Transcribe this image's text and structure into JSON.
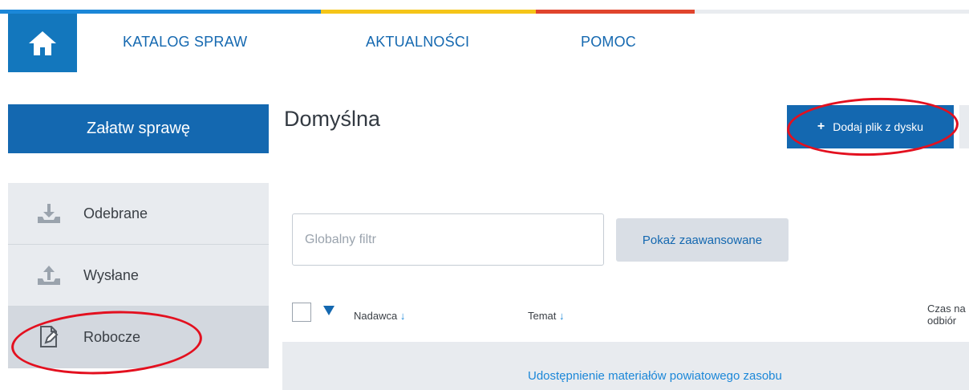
{
  "nav": {
    "home_label": "",
    "items": [
      {
        "label": "KATALOG SPRAW"
      },
      {
        "label": "AKTUALNOŚCI"
      },
      {
        "label": "POMOC"
      }
    ]
  },
  "primary_button": {
    "label": "Załatw sprawę"
  },
  "page": {
    "title": "Domyślna"
  },
  "toolbar": {
    "add_file_label": "Dodaj plik z dysku",
    "add_icon": "+"
  },
  "sidebar": {
    "items": [
      {
        "label": "Odebrane",
        "icon": "download-tray-icon"
      },
      {
        "label": "Wysłane",
        "icon": "upload-tray-icon"
      },
      {
        "label": "Robocze",
        "icon": "edit-document-icon"
      }
    ]
  },
  "filter": {
    "placeholder": "Globalny filtr",
    "advanced_label": "Pokaż zaawansowane"
  },
  "table": {
    "columns": [
      {
        "label": "Nadawca",
        "sort": "↓"
      },
      {
        "label": "Temat",
        "sort": "↓"
      },
      {
        "label_line1": "Czas na",
        "label_line2": "odbiór"
      }
    ],
    "rows": [
      {
        "subject": "Udostępnienie materiałów powiatowego zasobu"
      }
    ]
  },
  "colors": {
    "accent": "#1468b0",
    "link": "#1b87d8",
    "annotation": "#e3101f"
  }
}
